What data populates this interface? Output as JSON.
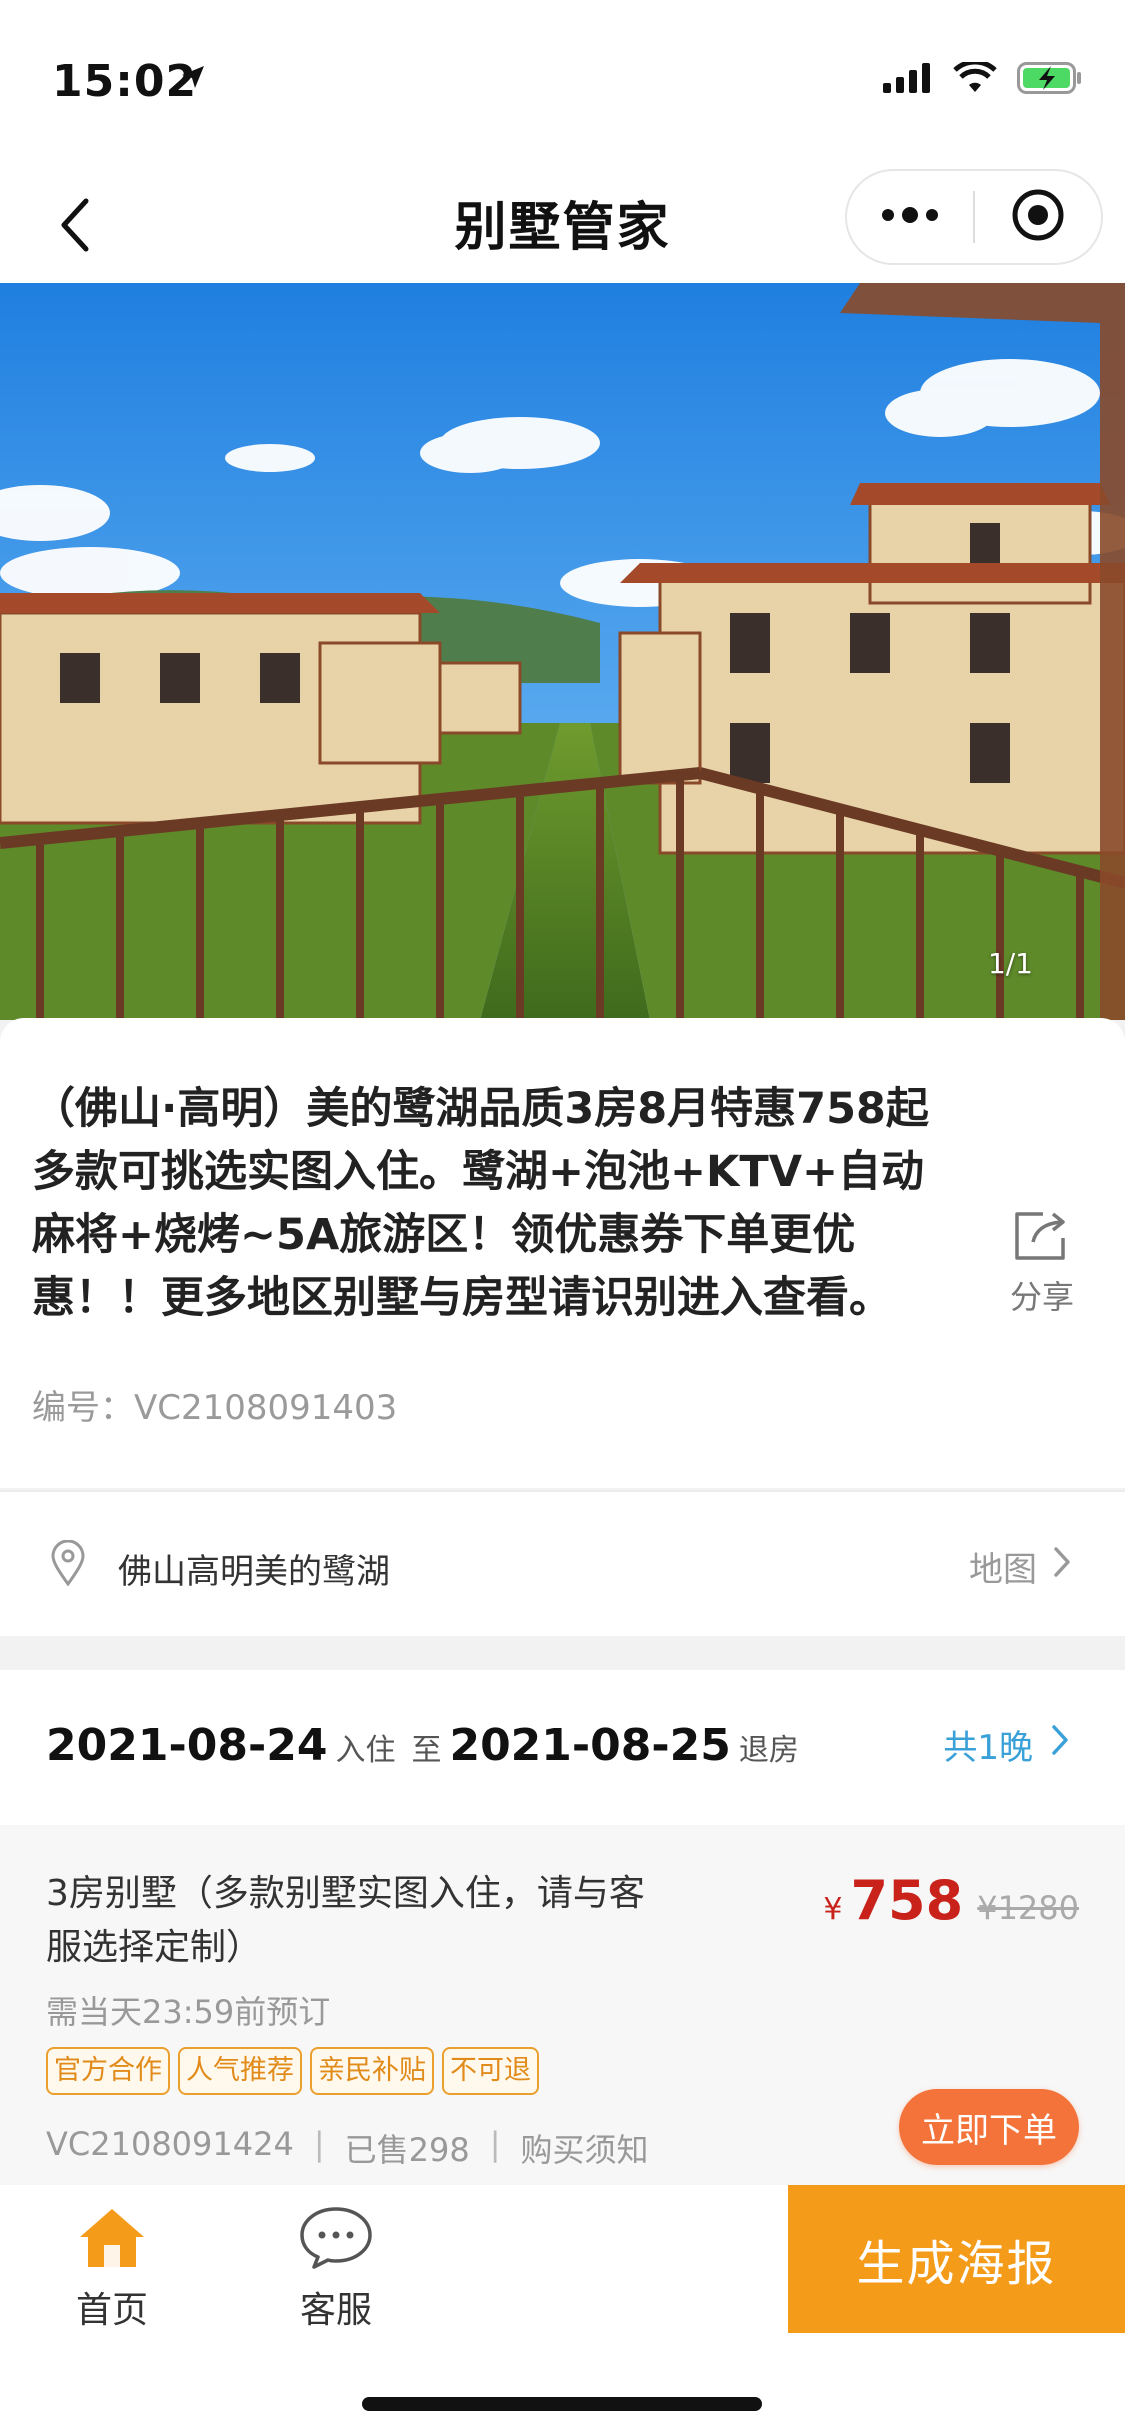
{
  "status_bar": {
    "time": "15:02"
  },
  "nav": {
    "title": "别墅管家"
  },
  "hero": {
    "counter": "1/1"
  },
  "listing": {
    "title": "（佛山·高明）美的鹭湖品质3房8月特惠758起多款可挑选实图入住。鹭湖+泡池+KTV+自动麻将+烧烤~5A旅游区！领优惠券下单更优惠！！更多地区别墅与房型请识别进入查看。",
    "code": "编号：VC2108091403",
    "share_label": "分享"
  },
  "location": {
    "text": "佛山高明美的鹭湖",
    "map_label": "地图"
  },
  "dates": {
    "checkin_date": "2021-08-24",
    "checkin_label": "入住",
    "to_label": "至",
    "checkout_date": "2021-08-25",
    "checkout_label": "退房",
    "nights": "共1晚"
  },
  "room": {
    "name": "3房别墅（多款别墅实图入住，请与客服选择定制）",
    "currency": "¥",
    "price": "758",
    "original_price": "¥1280",
    "deadline": "需当天23:59前预订",
    "tags": [
      "官方合作",
      "人气推荐",
      "亲民补贴",
      "不可退"
    ],
    "code": "VC2108091424",
    "sold": "已售298",
    "notice": "购买须知",
    "order_label": "立即下单"
  },
  "tab_bar": {
    "home_label": "首页",
    "service_label": "客服",
    "poster_label": "生成海报"
  },
  "colors": {
    "price_red": "#c8221b",
    "accent_orange": "#f49b1a",
    "order_orange": "#f4733b",
    "link_blue": "#3aa0d8"
  }
}
